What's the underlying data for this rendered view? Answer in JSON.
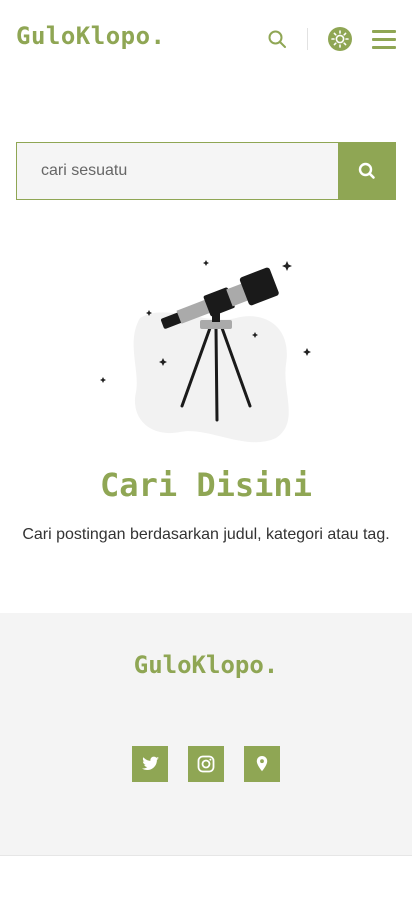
{
  "header": {
    "brand": "GuloKlopo.",
    "icons": {
      "search": "search-icon",
      "theme": "sun-icon",
      "menu": "hamburger-menu-icon"
    }
  },
  "search": {
    "placeholder": "cari sesuatu",
    "value": "",
    "submit_icon": "search-icon"
  },
  "hero": {
    "illustration": "telescope-illustration",
    "title": "Cari Disini",
    "subtitle": "Cari postingan berdasarkan judul, kategori atau tag."
  },
  "footer": {
    "brand": "GuloKlopo.",
    "social": [
      {
        "icon": "twitter-icon"
      },
      {
        "icon": "instagram-icon"
      },
      {
        "icon": "location-pin-icon"
      }
    ]
  },
  "colors": {
    "accent": "#8fa654",
    "footer_bg": "#f4f4f4"
  }
}
